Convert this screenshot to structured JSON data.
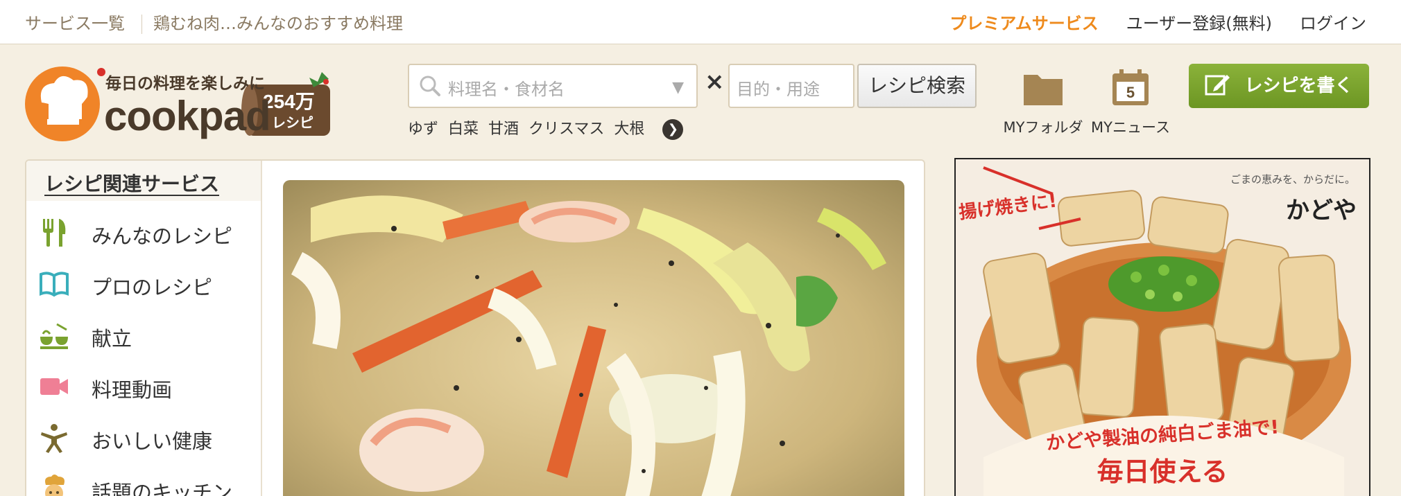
{
  "topbar": {
    "services": "サービス一覧",
    "topic": "鶏むね肉…みんなのおすすめ料理",
    "premium": "プレミアムサービス",
    "register": "ユーザー登録(無料)",
    "login": "ログイン"
  },
  "logo": {
    "tagline": "毎日の料理を楽しみに",
    "wordmark": "cookpad",
    "count": "254万",
    "count_unit": "レシピ"
  },
  "search": {
    "dish_placeholder": "料理名・食材名",
    "purpose_placeholder": "目的・用途",
    "button": "レシピ検索",
    "keywords": [
      "ゆず",
      "白菜",
      "甘酒",
      "クリスマス",
      "大根"
    ]
  },
  "header_icons": {
    "folder_label": "MYフォルダ",
    "news_label": "MYニュース",
    "news_count": "5"
  },
  "write_button": "レシピを書く",
  "sidebar": {
    "title": "レシピ関連サービス",
    "items": [
      {
        "label": "みんなのレシピ",
        "icon": "fork-knife-icon",
        "color": "#7aa22f"
      },
      {
        "label": "プロのレシピ",
        "icon": "open-book-icon",
        "color": "#3aaebb"
      },
      {
        "label": "献立",
        "icon": "meal-set-icon",
        "color": "#7aa22f"
      },
      {
        "label": "料理動画",
        "icon": "video-camera-icon",
        "color": "#ef7f95"
      },
      {
        "label": "おいしい健康",
        "icon": "person-health-icon",
        "color": "#7a6a30"
      },
      {
        "label": "話題のキッチン",
        "icon": "chef-face-icon",
        "color": "#e0a43a"
      }
    ]
  },
  "ad": {
    "brand_sub": "ごまの恵みを、からだに。",
    "brand": "かどや",
    "tag": "揚げ焼きに!",
    "copy1": "かどや製油の純白ごま油で!",
    "copy2": "毎日使える"
  },
  "colors": {
    "premium": "#ee8a1c",
    "accent_green": "#7aa22f",
    "logo_orange": "#f08428",
    "background": "#f5efe2"
  }
}
